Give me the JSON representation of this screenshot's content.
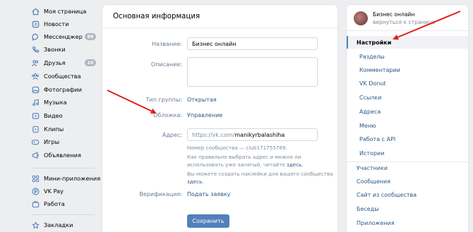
{
  "leftnav": {
    "items": [
      {
        "label": "Моя страница",
        "icon": "home-icon"
      },
      {
        "label": "Новости",
        "icon": "news-icon"
      },
      {
        "label": "Мессенджер",
        "icon": "message-icon",
        "badge": "88"
      },
      {
        "label": "Звонки",
        "icon": "phone-icon"
      },
      {
        "label": "Друзья",
        "icon": "friends-icon",
        "badge": "20"
      },
      {
        "label": "Сообщества",
        "icon": "communities-icon"
      },
      {
        "label": "Фотографии",
        "icon": "photo-icon"
      },
      {
        "label": "Музыка",
        "icon": "music-icon"
      },
      {
        "label": "Видео",
        "icon": "video-icon"
      },
      {
        "label": "Клипы",
        "icon": "clips-icon"
      },
      {
        "label": "Игры",
        "icon": "games-icon"
      },
      {
        "label": "Объявления",
        "icon": "ads-icon"
      },
      {
        "label": "Мини-приложения",
        "icon": "apps-icon"
      },
      {
        "label": "VK Pay",
        "icon": "vkpay-icon"
      },
      {
        "label": "Работа",
        "icon": "work-icon"
      },
      {
        "label": "Закладки",
        "icon": "bookmark-icon"
      }
    ]
  },
  "main": {
    "title": "Основная информация",
    "name_label": "Название:",
    "name_value": "Бизнес онлайн",
    "desc_label": "Описание:",
    "group_type_label": "Тип группы:",
    "group_type_value": "Открытая",
    "cover_label": "Обложка:",
    "cover_value": "Управление",
    "address_label": "Адрес:",
    "address_prefix": "https://vk.com/",
    "address_value": "manikyrbalashiha",
    "hint_number": "Номер сообщества — club171755789.",
    "hint_how_1": "Как правильно выбрать адрес и можно ли использовать уже занятый, читайте",
    "hint_how_link": "здесь",
    "hint_sticker_1": "Вы можете создать наклейки для вашего сообщества",
    "hint_sticker_link": "здесь",
    "verification_label": "Верификация:",
    "verification_value": "Подать заявку",
    "save_label": "Сохранить"
  },
  "rightmenu": {
    "community_name": "Бизнес онлайн",
    "back_text": "вернуться к странице",
    "items": [
      {
        "label": "Настройки",
        "kind": "active"
      },
      {
        "label": "Разделы",
        "kind": "sub"
      },
      {
        "label": "Комментарии",
        "kind": "sub"
      },
      {
        "label": "VK Donut",
        "kind": "sub"
      },
      {
        "label": "Ссылки",
        "kind": "sub"
      },
      {
        "label": "Адреса",
        "kind": "sub"
      },
      {
        "label": "Меню",
        "kind": "sub"
      },
      {
        "label": "Работа с API",
        "kind": "sub"
      },
      {
        "label": "Истории",
        "kind": "sub"
      },
      {
        "label": "Участники",
        "kind": "main"
      },
      {
        "label": "Сообщения",
        "kind": "main"
      },
      {
        "label": "Сайт из сообщества",
        "kind": "main"
      },
      {
        "label": "Беседы",
        "kind": "main"
      },
      {
        "label": "Приложения",
        "kind": "main"
      }
    ]
  },
  "colors": {
    "accent": "#5181b8",
    "link": "#2a5885",
    "arrow": "#e01e1e",
    "badge": "#aeb7c2"
  }
}
